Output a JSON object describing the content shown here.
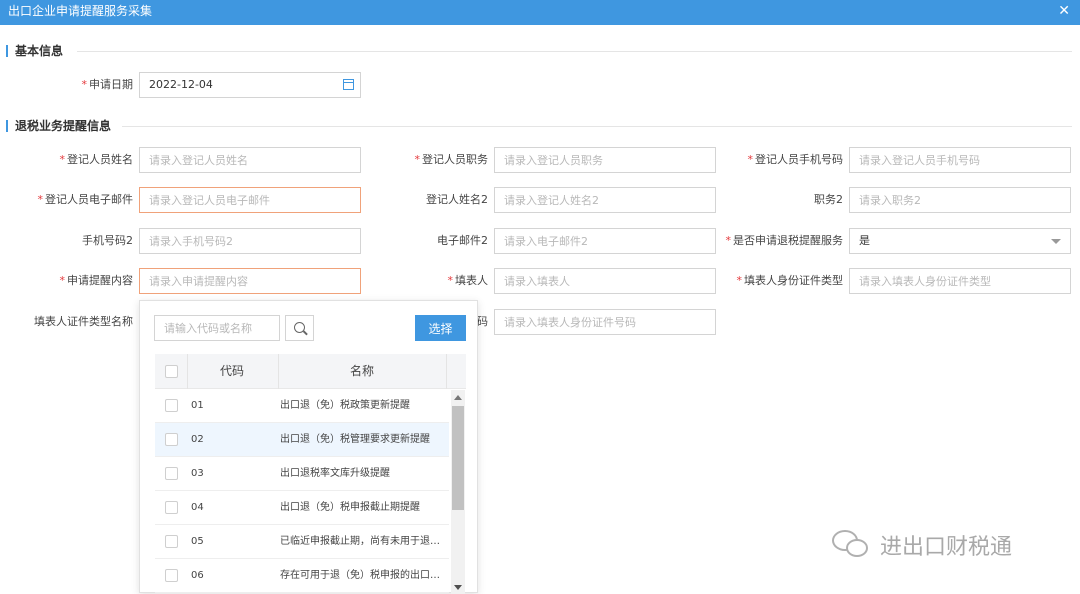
{
  "window": {
    "title": "出口企业申请提醒服务采集",
    "close_glyph": "✕"
  },
  "sections": {
    "basic": "基本信息",
    "refund": "退税业务提醒信息"
  },
  "fields": {
    "apply_date": {
      "label": "申请日期",
      "value": "2022-12-04"
    },
    "reg_name": {
      "label": "登记人员姓名",
      "placeholder": "请录入登记人员姓名"
    },
    "reg_position": {
      "label": "登记人员职务",
      "placeholder": "请录入登记人员职务"
    },
    "reg_phone": {
      "label": "登记人员手机号码",
      "placeholder": "请录入登记人员手机号码"
    },
    "reg_email": {
      "label": "登记人员电子邮件",
      "placeholder": "请录入登记人员电子邮件"
    },
    "reg_name2": {
      "label": "登记人姓名2",
      "placeholder": "请录入登记人姓名2"
    },
    "position2": {
      "label": "职务2",
      "placeholder": "请录入职务2"
    },
    "phone2": {
      "label": "手机号码2",
      "placeholder": "请录入手机号码2"
    },
    "email2": {
      "label": "电子邮件2",
      "placeholder": "请录入电子邮件2"
    },
    "apply_service": {
      "label": "是否申请退税提醒服务",
      "value": "是"
    },
    "remind_content": {
      "label": "申请提醒内容",
      "placeholder": "请录入申请提醒内容"
    },
    "filler": {
      "label": "填表人",
      "placeholder": "请录入填表人"
    },
    "filler_id_type": {
      "label": "填表人身份证件类型",
      "placeholder": "请录入填表人身份证件类型"
    },
    "filler_id_type_name": {
      "label": "填表人证件类型名称"
    },
    "filler_id_no": {
      "label_tail": "码",
      "placeholder": "请录入填表人身份证件号码"
    }
  },
  "dropdown": {
    "search_placeholder": "请输入代码或名称",
    "search_icon": "search-icon",
    "choose_label": "选择",
    "columns": {
      "code": "代码",
      "name": "名称"
    },
    "rows": [
      {
        "code": "01",
        "name": "出口退（免）税政策更新提醒"
      },
      {
        "code": "02",
        "name": "出口退（免）税管理要求更新提醒"
      },
      {
        "code": "03",
        "name": "出口退税率文库升级提醒"
      },
      {
        "code": "04",
        "name": "出口退（免）税申报截止期提醒"
      },
      {
        "code": "05",
        "name": "已临近申报截止期，尚有未用于退…"
      },
      {
        "code": "06",
        "name": "存在可用于退（免）税申报的出口…"
      }
    ]
  },
  "watermark": {
    "text": "进出口财税通",
    "icon": "wechat-icon"
  },
  "colors": {
    "accent": "#3f97e0",
    "required": "#e4393c",
    "error_border": "#f0a27a"
  }
}
